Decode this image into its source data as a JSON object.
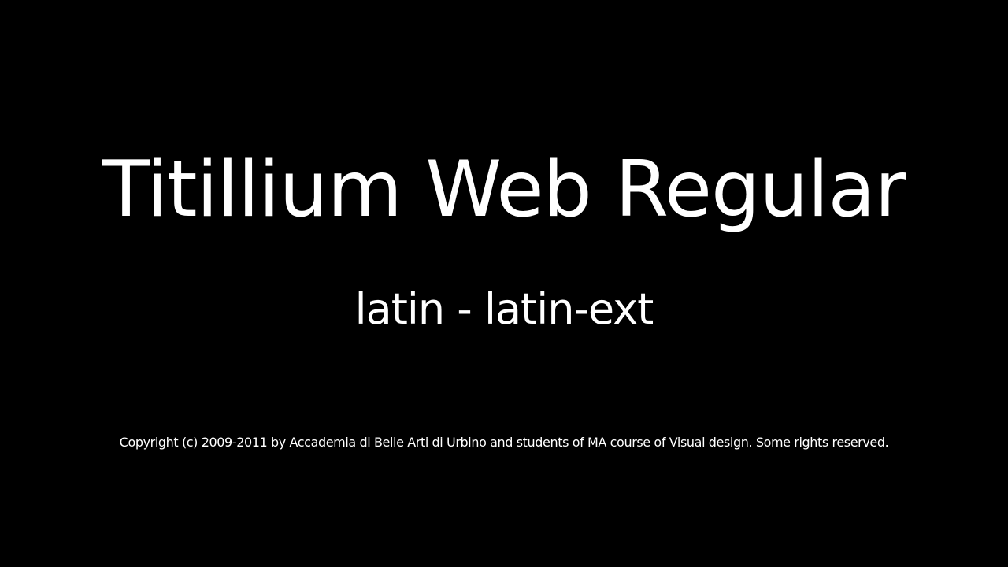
{
  "specimen": {
    "title": "Titillium Web Regular",
    "subtitle": "latin - latin-ext",
    "copyright": "Copyright (c) 2009-2011 by Accademia di Belle Arti di Urbino and students of MA course of Visual design. Some rights reserved."
  },
  "colors": {
    "background": "#000000",
    "text": "#ffffff"
  }
}
